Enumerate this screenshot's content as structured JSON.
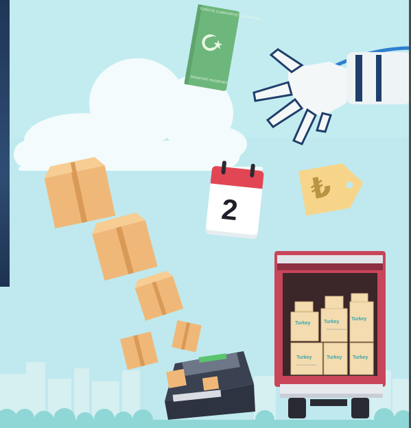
{
  "scene": {
    "passport": {
      "title_text": "TÜRKİYE CUMHURİYETİ PASAPORT",
      "bottom_text": "PASAPORT PASSPORT"
    },
    "calendar": {
      "day": "2"
    },
    "currency": {
      "symbol": "₺"
    },
    "truck_boxes": {
      "brand": "Turkey",
      "subtext": "Ordered Merchandise"
    }
  }
}
